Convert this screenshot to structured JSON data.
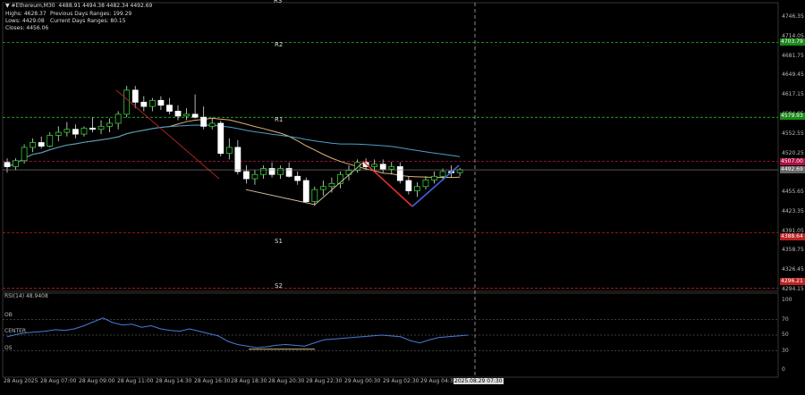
{
  "header": {
    "symbol_line": "▼ #Ethereum,M30  4488.91 4494.38 4482.34 4492.69",
    "highs": "Highs: 4628.37",
    "prev_range": "Previous Days Ranges: 199.29",
    "lows": "Lows: 4429.08",
    "curr_range": "Current Days Ranges: 80.15",
    "closes": "Closes: 4456.06"
  },
  "pivots": {
    "r2": {
      "label": "R2",
      "price": 4703.79,
      "tag": "4703.79",
      "color": "#33cc33"
    },
    "r1": {
      "label": "R1",
      "price": 4579.93,
      "tag": "4579.93",
      "color": "#33cc33"
    },
    "pp": {
      "label": "",
      "price": 4507.0,
      "tag": "4507.00",
      "color": "#cc2255"
    },
    "s1": {
      "label": "S1",
      "price": 4388.64,
      "tag": "4388.64",
      "color": "#cc2222"
    },
    "s2": {
      "label": "S2",
      "price": 4296.21,
      "tag": "4296.21",
      "color": "#cc2222"
    },
    "top_label": "R3"
  },
  "current_price": {
    "value": 4492.69,
    "tag": "4492.69"
  },
  "price_axis": [
    "4746.35",
    "4714.05",
    "4681.75",
    "4649.45",
    "4617.15",
    "4584.85",
    "4552.55",
    "4520.25",
    "4487.95",
    "4455.65",
    "4423.35",
    "4391.05",
    "4358.75",
    "4326.45",
    "4294.15"
  ],
  "time_axis": [
    "28 Aug 2025",
    "28 Aug 07:00",
    "28 Aug 09:00",
    "28 Aug 11:00",
    "28 Aug 14:30",
    "28 Aug 16:30",
    "28 Aug 18:30",
    "28 Aug 20:30",
    "28 Aug 22:30",
    "29 Aug 00:30",
    "29 Aug 02:30",
    "29 Aug 04:30",
    "2025.08.29 07:30"
  ],
  "rsi": {
    "title": "RSI(14) 48.9408",
    "ob_label": "OB",
    "center_label": "CENTER",
    "os_label": "OS",
    "axis": [
      "100",
      "70",
      "50",
      "30",
      "0"
    ],
    "values": [
      48,
      51,
      53,
      54,
      55,
      57,
      56,
      58,
      62,
      67,
      72,
      66,
      63,
      64,
      60,
      62,
      58,
      56,
      55,
      58,
      55,
      52,
      49,
      42,
      38,
      36,
      34,
      35,
      37,
      38,
      37,
      36,
      40,
      44,
      45,
      46,
      47,
      48,
      49,
      50,
      49,
      48,
      43,
      40,
      44,
      47,
      48,
      49,
      50
    ]
  },
  "candles": [
    [
      4505,
      4512,
      4488,
      4498
    ],
    [
      4498,
      4512,
      4492,
      4508
    ],
    [
      4508,
      4535,
      4503,
      4530
    ],
    [
      4530,
      4545,
      4522,
      4538
    ],
    [
      4538,
      4548,
      4528,
      4532
    ],
    [
      4532,
      4555,
      4530,
      4550
    ],
    [
      4550,
      4565,
      4540,
      4555
    ],
    [
      4555,
      4572,
      4548,
      4560
    ],
    [
      4560,
      4568,
      4545,
      4552
    ],
    [
      4552,
      4565,
      4548,
      4562
    ],
    [
      4562,
      4580,
      4555,
      4560
    ],
    [
      4560,
      4575,
      4552,
      4565
    ],
    [
      4565,
      4578,
      4555,
      4570
    ],
    [
      4570,
      4590,
      4560,
      4585
    ],
    [
      4585,
      4632,
      4580,
      4625
    ],
    [
      4625,
      4632,
      4595,
      4605
    ],
    [
      4605,
      4615,
      4590,
      4598
    ],
    [
      4598,
      4612,
      4590,
      4608
    ],
    [
      4608,
      4615,
      4592,
      4600
    ],
    [
      4600,
      4612,
      4585,
      4590
    ],
    [
      4590,
      4600,
      4575,
      4582
    ],
    [
      4582,
      4595,
      4575,
      4585
    ],
    [
      4585,
      4618,
      4578,
      4580
    ],
    [
      4580,
      4598,
      4560,
      4565
    ],
    [
      4565,
      4578,
      4560,
      4570
    ],
    [
      4570,
      4574,
      4515,
      4520
    ],
    [
      4520,
      4545,
      4510,
      4530
    ],
    [
      4530,
      4542,
      4485,
      4490
    ],
    [
      4490,
      4500,
      4470,
      4478
    ],
    [
      4478,
      4492,
      4468,
      4485
    ],
    [
      4485,
      4500,
      4478,
      4495
    ],
    [
      4495,
      4505,
      4480,
      4485
    ],
    [
      4485,
      4500,
      4478,
      4495
    ],
    [
      4495,
      4505,
      4480,
      4482
    ],
    [
      4482,
      4490,
      4468,
      4475
    ],
    [
      4475,
      4480,
      4438,
      4440
    ],
    [
      4440,
      4465,
      4433,
      4460
    ],
    [
      4460,
      4475,
      4450,
      4465
    ],
    [
      4465,
      4480,
      4455,
      4470
    ],
    [
      4470,
      4490,
      4462,
      4485
    ],
    [
      4485,
      4500,
      4475,
      4492
    ],
    [
      4492,
      4510,
      4488,
      4505
    ],
    [
      4505,
      4512,
      4492,
      4498
    ],
    [
      4498,
      4510,
      4490,
      4502
    ],
    [
      4502,
      4510,
      4488,
      4494
    ],
    [
      4494,
      4506,
      4485,
      4498
    ],
    [
      4498,
      4505,
      4470,
      4475
    ],
    [
      4475,
      4482,
      4452,
      4458
    ],
    [
      4458,
      4472,
      4448,
      4465
    ],
    [
      4465,
      4482,
      4460,
      4476
    ],
    [
      4476,
      4490,
      4470,
      4482
    ],
    [
      4482,
      4495,
      4475,
      4490
    ],
    [
      4490,
      4500,
      4480,
      4488
    ],
    [
      4488,
      4496,
      4482,
      4493
    ]
  ],
  "zigzag_orange": [
    [
      4488,
      4507
    ],
    [
      4522,
      4425
    ],
    [
      4560,
      4340
    ],
    [
      4605,
      4420
    ],
    [
      4655,
      4296
    ]
  ]
}
